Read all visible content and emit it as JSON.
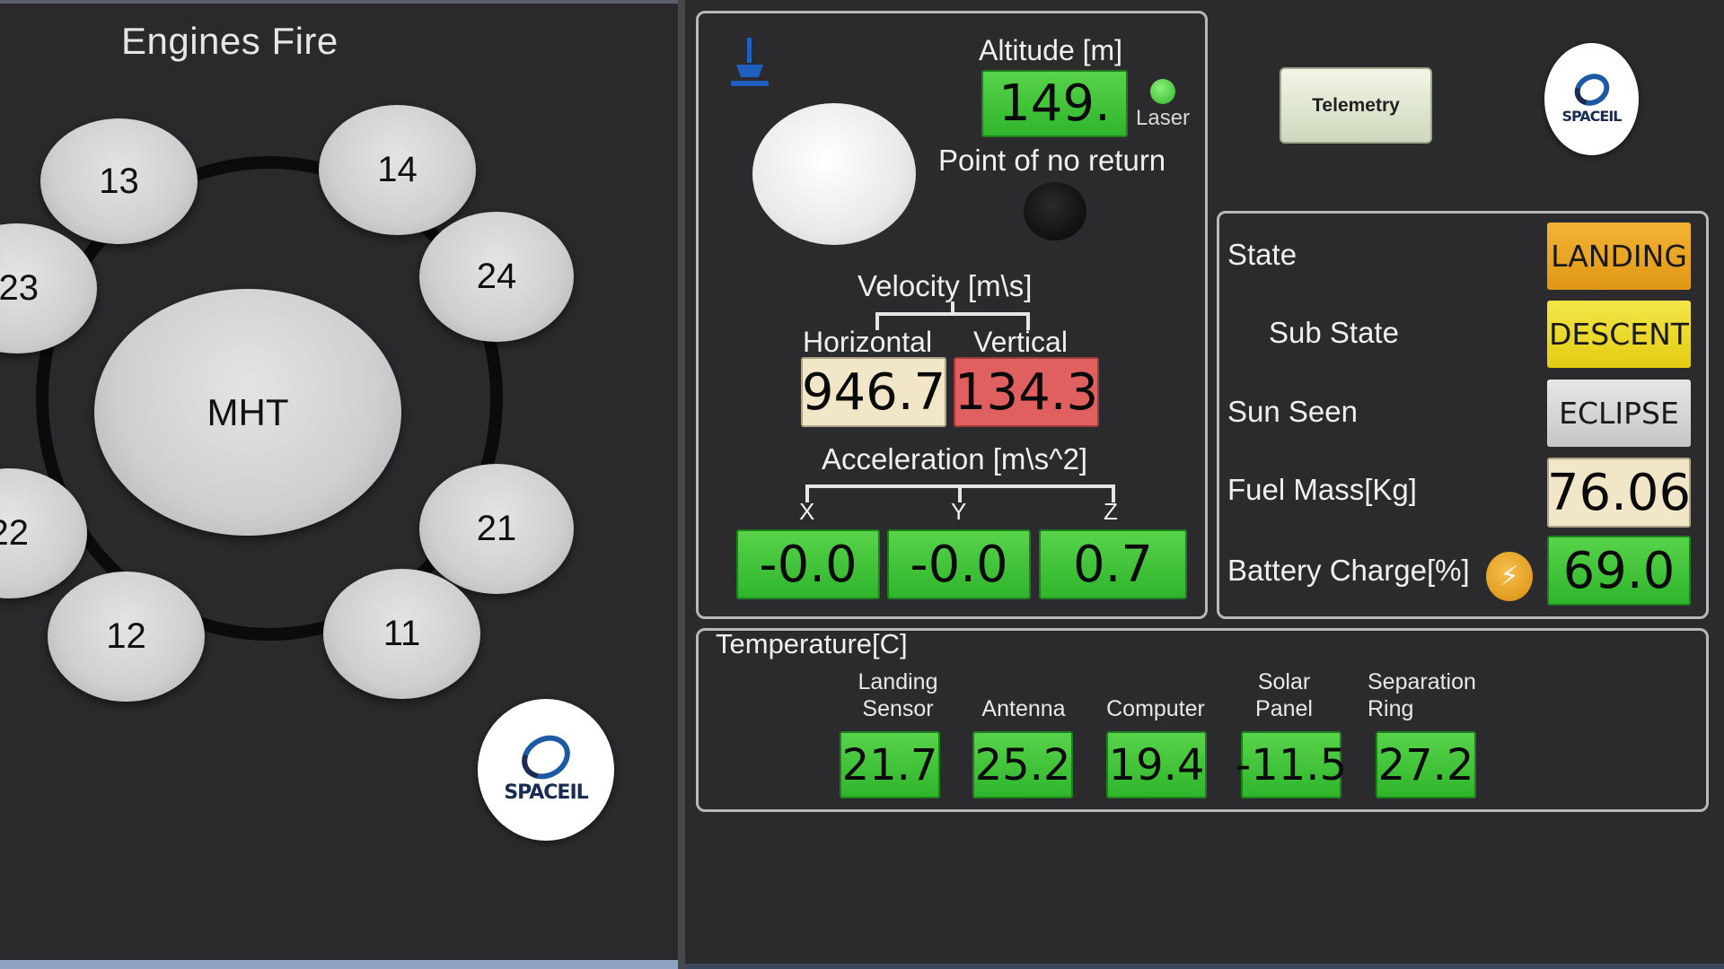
{
  "engines_panel": {
    "title": "Engines Fire",
    "engines": [
      "13",
      "14",
      "23",
      "24",
      "MHT",
      "22",
      "21",
      "12",
      "11"
    ],
    "logo_text": "SPACEIL"
  },
  "flight_panel": {
    "altitude": {
      "label": "Altitude [m]",
      "value": "149."
    },
    "laser_label": "Laser",
    "point_of_no_return_label": "Point of no return",
    "velocity": {
      "label": "Velocity [m\\s]",
      "horizontal_label": "Horizontal",
      "vertical_label": "Vertical",
      "horizontal_value": "946.7",
      "vertical_value": "134.3"
    },
    "acceleration": {
      "label": "Acceleration [m\\s^2]",
      "x_label": "X",
      "y_label": "Y",
      "z_label": "Z",
      "x_value": "-0.0",
      "y_value": "-0.0",
      "z_value": "0.7"
    }
  },
  "toolbar": {
    "telemetry_button": "Telemetry"
  },
  "status_panel": {
    "state": {
      "label": "State",
      "value": "LANDING"
    },
    "sub_state": {
      "label": "Sub State",
      "value": "DESCENT"
    },
    "sun_seen": {
      "label": "Sun Seen",
      "value": "ECLIPSE"
    },
    "fuel_mass": {
      "label": "Fuel Mass[Kg]",
      "value": "76.06"
    },
    "battery_charge": {
      "label": "Battery Charge[%]",
      "value": "69.0"
    }
  },
  "temperature_panel": {
    "title": "Temperature[C]",
    "sensors": [
      {
        "label_line1": "Landing",
        "label_line2": "Sensor",
        "value": "21.7"
      },
      {
        "label_line1": "Antenna",
        "label_line2": "",
        "value": "25.2"
      },
      {
        "label_line1": "Computer",
        "label_line2": "",
        "value": "19.4"
      },
      {
        "label_line1": "Solar",
        "label_line2": "Panel",
        "value": "-11.5"
      },
      {
        "label_line1": "Separation",
        "label_line2": "Ring",
        "value": "27.2"
      }
    ]
  },
  "colors": {
    "green_box": "#3cc034",
    "landing_orange": "#e8a11c",
    "descent_yellow": "#e8d21a",
    "eclipse_gray": "#d2d2d2",
    "cream": "#f2e6c8",
    "vertical_red": "#e06060"
  },
  "icons": [
    "ship-icon",
    "laser-indicator-icon",
    "point-of-no-return-indicator-icon",
    "lightning-icon",
    "spaceil-logo-icon"
  ]
}
